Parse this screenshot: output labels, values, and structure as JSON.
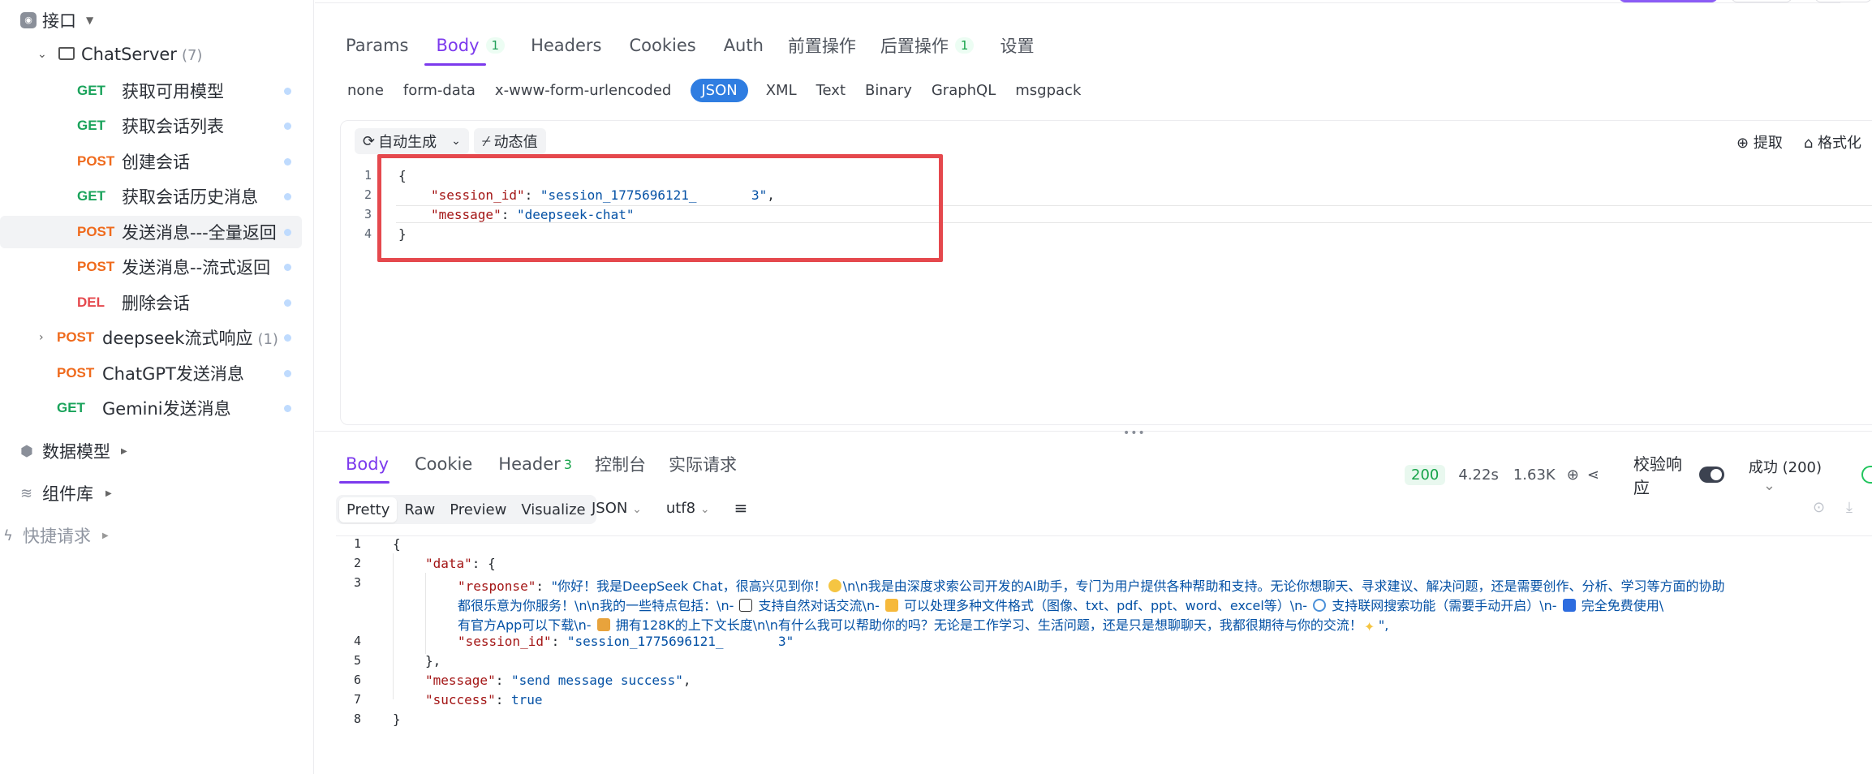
{
  "sidebar": {
    "root": {
      "label": "接口"
    },
    "folder": {
      "label": "ChatServer",
      "count": "(7)"
    },
    "items": [
      {
        "method": "GET",
        "label": "获取可用模型"
      },
      {
        "method": "GET",
        "label": "获取会话列表"
      },
      {
        "method": "POST",
        "label": "创建会话"
      },
      {
        "method": "GET",
        "label": "获取会话历史消息"
      },
      {
        "method": "POST",
        "label": "发送消息---全量返回"
      },
      {
        "method": "POST",
        "label": "发送消息--流式返回"
      },
      {
        "method": "DEL",
        "label": "删除会话"
      }
    ],
    "group_item": {
      "method": "POST",
      "label": "deepseek流式响应",
      "count": "(1)"
    },
    "top_items": [
      {
        "method": "POST",
        "label": "ChatGPT发送消息"
      },
      {
        "method": "GET",
        "label": "Gemini发送消息"
      }
    ],
    "sections": {
      "models": "数据模型",
      "components": "组件库",
      "quick": "快捷请求"
    }
  },
  "request_tabs": {
    "params": "Params",
    "body": "Body",
    "body_count": "1",
    "headers": "Headers",
    "cookies": "Cookies",
    "auth": "Auth",
    "pre": "前置操作",
    "post": "后置操作",
    "post_count": "1",
    "settings": "设置"
  },
  "body_types": [
    "none",
    "form-data",
    "x-www-form-urlencoded",
    "JSON",
    "XML",
    "Text",
    "Binary",
    "GraphQL",
    "msgpack"
  ],
  "body_types_active": "JSON",
  "editor_toolbar": {
    "auto_gen": "自动生成",
    "dynamic": "动态值",
    "extract": "提取",
    "format": "格式化"
  },
  "request_body": {
    "line_numbers": [
      "1",
      "2",
      "3",
      "4"
    ],
    "open": "{",
    "k1": "\"session_id\"",
    "v1": "\"session_1775696121_       3\"",
    "k2": "\"message\"",
    "v2": "\"deepseek-chat\"",
    "close": "}"
  },
  "response_tabs": {
    "body": "Body",
    "cookie": "Cookie",
    "header": "Header",
    "header_count": "3",
    "console": "控制台",
    "actual": "实际请求"
  },
  "response_meta": {
    "status": "200",
    "time": "4.22s",
    "size": "1.63K",
    "validate": "校验响应",
    "result": "成功 (200)"
  },
  "view_tabs": [
    "Pretty",
    "Raw",
    "Preview",
    "Visualize"
  ],
  "view_active": "Pretty",
  "format_select": "JSON",
  "encoding_select": "utf8",
  "response_body": {
    "line_numbers": [
      "1",
      "2",
      "3",
      "4",
      "5",
      "6",
      "7",
      "8"
    ],
    "l1": "{",
    "l2k": "\"data\"",
    "l2p": ": {",
    "l3k": "\"response\"",
    "l3v_a": "\"你好！我是DeepSeek Chat，很高兴见到你！",
    "l3v_b": "\\n\\n我是由深度求索公司开发的AI助手，专门为用户提供各种帮助和支持。无论你想聊天、寻求建议、解决问题，还是需要创作、分析、学习等方面的协助",
    "l3v_c": "都很乐意为你服务！\\n\\n我的一些特点包括：\\n-",
    "l3v_d": " 支持自然对话交流\\n-",
    "l3v_e": " 可以处理多种文件格式（图像、txt、pdf、ppt、word、excel等）\\n-",
    "l3v_f": " 支持联网搜索功能（需要手动开启）\\n-",
    "l3v_g": " 完全免费使用\\",
    "l3v_h": "有官方App可以下载\\n-",
    "l3v_i": " 拥有128K的上下文长度\\n\\n有什么我可以帮助你的吗？无论是工作学习、生活问题，还是只是想聊聊天，我都很期待与你的交流！",
    "l3v_j": "\",",
    "l4k": "\"session_id\"",
    "l4v": "\"session_1775696121_       3\"",
    "l5": "},",
    "l6k": "\"message\"",
    "l6v": "\"send message success\"",
    "l7k": "\"success\"",
    "l7v": "true",
    "l8": "}"
  },
  "colors": {
    "accent": "#7c3aed",
    "get": "#1aa35b",
    "post": "#ef6a1c",
    "del": "#e5484d",
    "highlight": "#e5484d",
    "json_pill": "#2f7de1"
  }
}
